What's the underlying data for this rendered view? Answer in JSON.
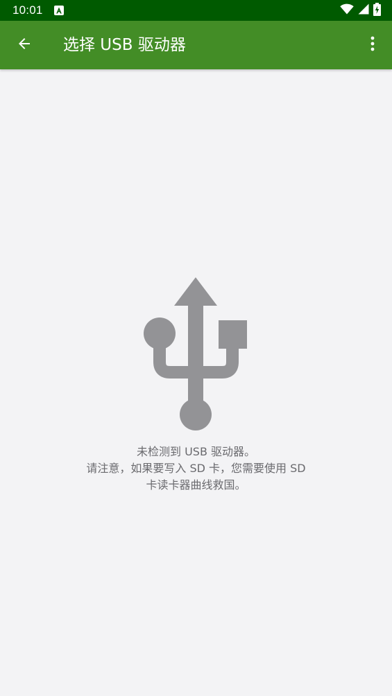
{
  "status_bar": {
    "time": "10:01",
    "icons": [
      "notification-a-icon",
      "wifi-icon",
      "cell-signal-icon",
      "battery-charging-icon"
    ]
  },
  "app_bar": {
    "back_icon": "arrow-back-icon",
    "title": "选择 USB 驱动器",
    "overflow_icon": "more-vert-icon",
    "background_color": "#438d26"
  },
  "empty_state": {
    "icon": "usb-icon",
    "icon_color": "#939396",
    "line1": "未检测到 USB 驱动器。",
    "line2": "请注意，如果要写入 SD 卡，您需要使用 SD",
    "line3": "卡读卡器曲线救国。"
  },
  "colors": {
    "status_bar": "#005a00",
    "background": "#f3f3f5",
    "text_secondary": "#6a6a6e"
  }
}
